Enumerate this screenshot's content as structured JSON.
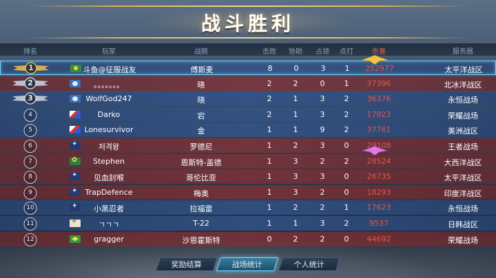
{
  "title": "战斗胜利",
  "headers": {
    "rank": "排名",
    "player": "玩家",
    "ship": "战舰",
    "kills": "击败",
    "assists": "协助",
    "occupy": "占领",
    "lights": "点灯",
    "damage": "伤害",
    "server": "服务器"
  },
  "rows": [
    {
      "rank": "1",
      "player": "斗鱼@征服战友",
      "ship": "傅斯麦",
      "kills": "8",
      "assists": "0",
      "occupy": "3",
      "lights": "1",
      "damage": "252977",
      "server": "太平洋战区",
      "flag": "f-green",
      "team": "blue",
      "self": true
    },
    {
      "rank": "2",
      "player": "。。。。。。。",
      "ship": "晓",
      "kills": "2",
      "assists": "2",
      "occupy": "0",
      "lights": "1",
      "damage": "37396",
      "server": "北冰洋战区",
      "flag": "f-blue",
      "team": "red"
    },
    {
      "rank": "3",
      "player": "WolfGod247",
      "ship": "晓",
      "kills": "2",
      "assists": "1",
      "occupy": "3",
      "lights": "2",
      "damage": "36376",
      "server": "永恒战场",
      "flag": "f-blue",
      "team": "blue"
    },
    {
      "rank": "4",
      "player": "Darko",
      "ship": "宕",
      "kills": "2",
      "assists": "1",
      "occupy": "3",
      "lights": "2",
      "damage": "17023",
      "server": "荣耀战场",
      "flag": "f-red",
      "team": "blue"
    },
    {
      "rank": "5",
      "player": "Lonesurvivor",
      "ship": "金",
      "kills": "1",
      "assists": "1",
      "occupy": "9",
      "lights": "2",
      "damage": "37761",
      "server": "美洲战区",
      "flag": "f-red",
      "team": "blue"
    },
    {
      "rank": "6",
      "player": "저격왕",
      "ship": "罗德尼",
      "kills": "1",
      "assists": "2",
      "occupy": "3",
      "lights": "0",
      "damage": "29108",
      "server": "王者战场",
      "flag": "f-dark",
      "team": "red"
    },
    {
      "rank": "7",
      "player": "Stephen",
      "ship": "恩斯特-盖德",
      "kills": "1",
      "assists": "3",
      "occupy": "2",
      "lights": "2",
      "damage": "28524",
      "server": "大西洋战区",
      "flag": "f-hk",
      "team": "red"
    },
    {
      "rank": "8",
      "player": "见血封喉",
      "ship": "哥伦比亚",
      "kills": "1",
      "assists": "3",
      "occupy": "3",
      "lights": "0",
      "damage": "26735",
      "server": "太平洋战区",
      "flag": "f-dark",
      "team": "red"
    },
    {
      "rank": "9",
      "player": "TrapDefence",
      "ship": "梅奥",
      "kills": "1",
      "assists": "3",
      "occupy": "2",
      "lights": "0",
      "damage": "18293",
      "server": "印度洋战区",
      "flag": "f-dark",
      "team": "red"
    },
    {
      "rank": "10",
      "player": "小黑忍者",
      "ship": "拉福雷",
      "kills": "1",
      "assists": "2",
      "occupy": "2",
      "lights": "1",
      "damage": "17623",
      "server": "永恒战场",
      "flag": "f-dark",
      "team": "blue"
    },
    {
      "rank": "11",
      "player": "ㄱㄱㄱ",
      "ship": "T-22",
      "kills": "1",
      "assists": "1",
      "occupy": "3",
      "lights": "2",
      "damage": "9537",
      "server": "日韩战区",
      "flag": "f-sk",
      "team": "blue"
    },
    {
      "rank": "12",
      "player": "gragger",
      "ship": "沙恩霍斯特",
      "kills": "0",
      "assists": "2",
      "occupy": "2",
      "lights": "0",
      "damage": "44692",
      "server": "荣耀战场",
      "flag": "f-br",
      "team": "red"
    }
  ],
  "tabs": {
    "rewards": "奖励结算",
    "battle_stats": "战场统计",
    "personal_stats": "个人统计"
  },
  "colors": {
    "damage": "#e2574c",
    "gold": "#f2d98a",
    "active_tab": "#7fd8ff"
  }
}
